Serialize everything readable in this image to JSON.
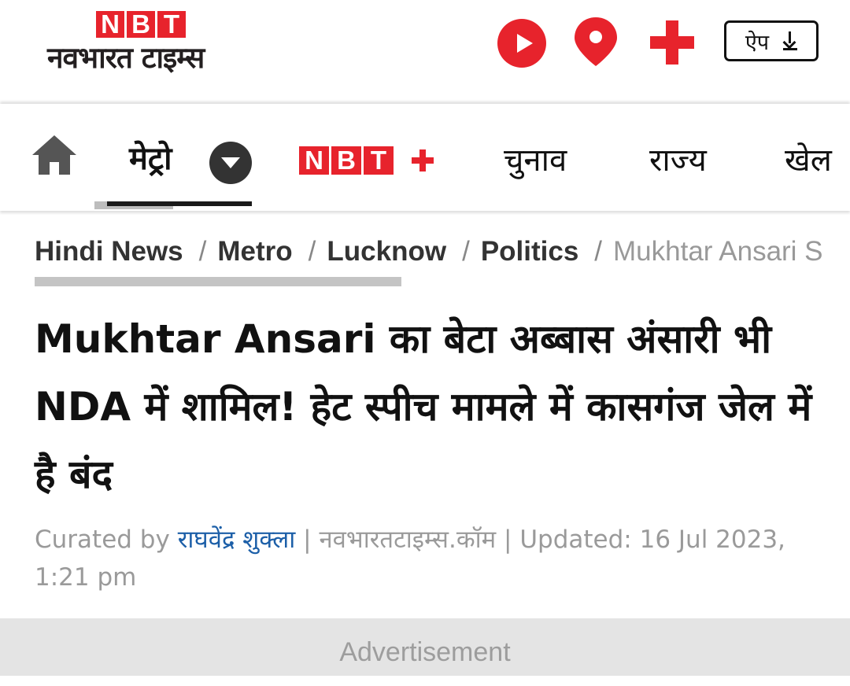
{
  "header": {
    "logo_letters": [
      "N",
      "B",
      "T"
    ],
    "logo_hindi": "नवभारत टाइम्स",
    "app_button_label": "ऐप",
    "accent_color": "#e7232c",
    "icons": [
      "play-icon",
      "location-pin-icon",
      "plus-icon",
      "download-icon"
    ]
  },
  "nav": {
    "home_icon": "home-icon",
    "active_item": "मेट्रो",
    "nbt_plus_letters": [
      "N",
      "B",
      "T"
    ],
    "items": [
      "चुनाव",
      "राज्य",
      "खेल"
    ]
  },
  "breadcrumb": {
    "items": [
      "Hindi News",
      "Metro",
      "Lucknow",
      "Politics"
    ],
    "separator": "/",
    "current": "Mukhtar Ansari S"
  },
  "article": {
    "headline": "Mukhtar Ansari का बेटा अब्बास अंसारी भी NDA में शामिल! हेट स्पीच मामले में कासगंज जेल में है बंद",
    "curated_by_label": "Curated by",
    "author": "राघवेंद्र शुक्ला",
    "source": "| नवभारतटाइम्स.कॉम |",
    "updated": "Updated: 16 Jul 2023, 1:21 pm"
  },
  "ad": {
    "label": "Advertisement"
  }
}
